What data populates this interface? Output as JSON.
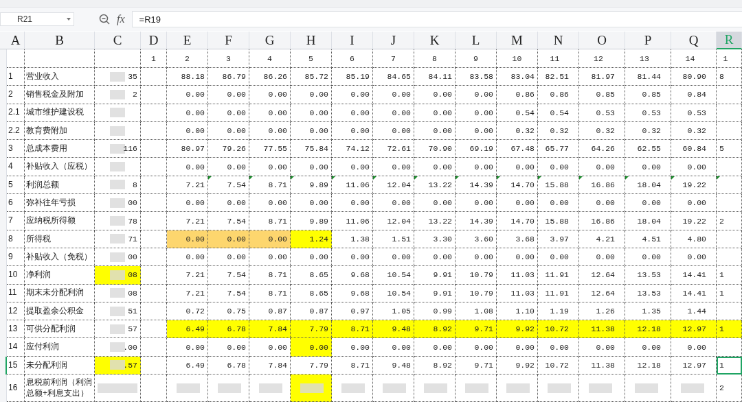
{
  "name_box": "R21",
  "function_label": "fx",
  "formula": "=R19",
  "columns": [
    {
      "label": "A",
      "selected": false
    },
    {
      "label": "B",
      "selected": false
    },
    {
      "label": "C",
      "selected": false
    },
    {
      "label": "D",
      "selected": false
    },
    {
      "label": "E",
      "selected": false
    },
    {
      "label": "F",
      "selected": false
    },
    {
      "label": "G",
      "selected": false
    },
    {
      "label": "H",
      "selected": false
    },
    {
      "label": "I",
      "selected": false
    },
    {
      "label": "J",
      "selected": false
    },
    {
      "label": "K",
      "selected": false
    },
    {
      "label": "L",
      "selected": false
    },
    {
      "label": "M",
      "selected": false
    },
    {
      "label": "N",
      "selected": false
    },
    {
      "label": "O",
      "selected": false
    },
    {
      "label": "P",
      "selected": false
    },
    {
      "label": "Q",
      "selected": false
    },
    {
      "label": "R",
      "selected": true
    }
  ],
  "rows": [
    {
      "a": null,
      "b": null,
      "c": null,
      "selected": false,
      "cells": [
        "1",
        "2",
        "3",
        "4",
        "5",
        "6",
        "7",
        "8",
        "9",
        "10",
        "11",
        "12",
        "13",
        "14",
        "1"
      ]
    },
    {
      "a": "1",
      "b": "营业收入",
      "c": "35",
      "selected": false,
      "cells": [
        null,
        "88.18",
        "86.79",
        "86.26",
        "85.72",
        "85.19",
        "84.65",
        "84.11",
        "83.58",
        "83.04",
        "82.51",
        "81.97",
        "81.44",
        "80.90",
        "8"
      ]
    },
    {
      "a": "2",
      "b": "销售税金及附加",
      "c": "2",
      "selected": false,
      "cells": [
        null,
        "0.00",
        "0.00",
        "0.00",
        "0.00",
        "0.00",
        "0.00",
        "0.00",
        "0.00",
        "0.86",
        "0.86",
        "0.85",
        "0.85",
        "0.84",
        null
      ]
    },
    {
      "a": "2.1",
      "b": "城市维护建设税",
      "c": null,
      "selected": false,
      "cells": [
        null,
        "0.00",
        "0.00",
        "0.00",
        "0.00",
        "0.00",
        "0.00",
        "0.00",
        "0.00",
        "0.54",
        "0.54",
        "0.53",
        "0.53",
        "0.53",
        null
      ]
    },
    {
      "a": "2.2",
      "b": "教育费附加",
      "c": null,
      "selected": false,
      "cells": [
        null,
        "0.00",
        "0.00",
        "0.00",
        "0.00",
        "0.00",
        "0.00",
        "0.00",
        "0.00",
        "0.32",
        "0.32",
        "0.32",
        "0.32",
        "0.32",
        null
      ]
    },
    {
      "a": "3",
      "b": "总成本费用",
      "c": "116",
      "selected": false,
      "cells": [
        null,
        "80.97",
        "79.26",
        "77.55",
        "75.84",
        "74.12",
        "72.61",
        "70.90",
        "69.19",
        "67.48",
        "65.77",
        "64.26",
        "62.55",
        "60.84",
        "5"
      ]
    },
    {
      "a": "4",
      "b": "补贴收入（应税）",
      "c": null,
      "selected": false,
      "cells": [
        null,
        "0.00",
        "0.00",
        "0.00",
        "0.00",
        "0.00",
        "0.00",
        "0.00",
        "0.00",
        "0.00",
        "0.00",
        "0.00",
        "0.00",
        "0.00",
        null
      ]
    },
    {
      "a": "5",
      "b": "利润总额",
      "c": "8",
      "selected": false,
      "cells": [
        null,
        "7.21",
        {
          "text": "7.54",
          "flag": true
        },
        {
          "text": "8.71",
          "flag": true
        },
        {
          "text": "9.89",
          "flag": true
        },
        {
          "text": "11.06",
          "flag": true
        },
        {
          "text": "12.04",
          "flag": true
        },
        {
          "text": "13.22",
          "flag": true
        },
        {
          "text": "14.39",
          "flag": true
        },
        {
          "text": "14.70",
          "flag": true
        },
        {
          "text": "15.88",
          "flag": true
        },
        {
          "text": "16.86",
          "flag": true
        },
        {
          "text": "18.04",
          "flag": true
        },
        {
          "text": "19.22",
          "flag": true
        },
        {
          "text": null,
          "flag": true
        }
      ]
    },
    {
      "a": "6",
      "b": "弥补往年亏损",
      "c": "00",
      "selected": false,
      "cells": [
        null,
        "0.00",
        "0.00",
        "0.00",
        "0.00",
        "0.00",
        "0.00",
        "0.00",
        "0.00",
        "0.00",
        "0.00",
        "0.00",
        "0.00",
        "0.00",
        null
      ]
    },
    {
      "a": "7",
      "b": "应纳税所得额",
      "c": "78",
      "selected": false,
      "cells": [
        null,
        "7.21",
        "7.54",
        "8.71",
        "9.89",
        "11.06",
        "12.04",
        "13.22",
        "14.39",
        "14.70",
        "15.88",
        "16.86",
        "18.04",
        "19.22",
        "2"
      ]
    },
    {
      "a": "8",
      "b": "所得税",
      "c": "71",
      "selected": false,
      "cells": [
        null,
        {
          "text": "0.00",
          "color": "#fdd66e"
        },
        {
          "text": "0.00",
          "color": "#fdd66e"
        },
        {
          "text": "0.00",
          "color": "#fdd66e"
        },
        {
          "text": "1.24",
          "color": "#ffff00"
        },
        "1.38",
        "1.51",
        "3.30",
        "3.60",
        "3.68",
        "3.97",
        "4.21",
        "4.51",
        "4.80",
        null
      ]
    },
    {
      "a": "9",
      "b": "补贴收入（免税）",
      "c": "00",
      "selected": false,
      "cells": [
        null,
        "0.00",
        "0.00",
        "0.00",
        "0.00",
        "0.00",
        "0.00",
        "0.00",
        "0.00",
        "0.00",
        "0.00",
        "0.00",
        "0.00",
        "0.00",
        null
      ]
    },
    {
      "a": "10",
      "b": "净利润",
      "c": {
        "text": "08",
        "color": "#ffff00"
      },
      "selected": false,
      "cells": [
        null,
        "7.21",
        "7.54",
        "8.71",
        "8.65",
        "9.68",
        "10.54",
        "9.91",
        "10.79",
        "11.03",
        "11.91",
        "12.64",
        "13.53",
        "14.41",
        "1"
      ]
    },
    {
      "a": "11",
      "b": "期末未分配利润",
      "c": "08",
      "selected": false,
      "cells": [
        null,
        "7.21",
        "7.54",
        "8.71",
        "8.65",
        "9.68",
        "10.54",
        "9.91",
        "10.79",
        "11.03",
        "11.91",
        "12.64",
        "13.53",
        "14.41",
        "1"
      ]
    },
    {
      "a": "12",
      "b": "提取盈余公积金",
      "c": "51",
      "selected": false,
      "cells": [
        null,
        "0.72",
        "0.75",
        "0.87",
        "0.87",
        "0.97",
        "1.05",
        "0.99",
        "1.08",
        "1.10",
        "1.19",
        "1.26",
        "1.35",
        "1.44",
        null
      ]
    },
    {
      "a": "13",
      "b": "可供分配利润",
      "c": "57",
      "selected": false,
      "cells": [
        null,
        {
          "text": "6.49",
          "color": "#ffff00"
        },
        {
          "text": "6.78",
          "color": "#ffff00"
        },
        {
          "text": "7.84",
          "color": "#ffff00"
        },
        {
          "text": "7.79",
          "color": "#ffff00"
        },
        {
          "text": "8.71",
          "color": "#ffff00"
        },
        {
          "text": "9.48",
          "color": "#ffff00"
        },
        {
          "text": "8.92",
          "color": "#ffff00"
        },
        {
          "text": "9.71",
          "color": "#ffff00"
        },
        {
          "text": "9.92",
          "color": "#ffff00"
        },
        {
          "text": "10.72",
          "color": "#ffff00"
        },
        {
          "text": "11.38",
          "color": "#ffff00"
        },
        {
          "text": "12.18",
          "color": "#ffff00"
        },
        {
          "text": "12.97",
          "color": "#ffff00"
        },
        {
          "text": "1",
          "color": "#ffff00"
        }
      ]
    },
    {
      "a": "14",
      "b": "应付利润",
      "c": ".00",
      "selected": false,
      "cells": [
        null,
        "0.00",
        "0.00",
        "0.00",
        {
          "text": "0.00",
          "color": "#ffff00"
        },
        "0.00",
        "0.00",
        "0.00",
        "0.00",
        "0.00",
        "0.00",
        "0.00",
        "0.00",
        "0.00",
        null
      ]
    },
    {
      "a": "15",
      "b": "未分配利润",
      "c": {
        "text": ".57",
        "color": "#ffff00"
      },
      "selected": true,
      "cells": [
        null,
        "6.49",
        "6.78",
        "7.84",
        "7.79",
        "8.71",
        "9.48",
        "8.92",
        "9.71",
        "9.92",
        "10.72",
        "11.38",
        "12.18",
        "12.97",
        {
          "text": "1",
          "active": true
        }
      ]
    },
    {
      "a": "16",
      "b": "息税前利润（利润总额+利息支出）",
      "c": null,
      "blurred": true,
      "selected": false,
      "cells": [
        null,
        null,
        null,
        null,
        {
          "text": null,
          "color": "#ffff00"
        },
        null,
        null,
        null,
        null,
        null,
        null,
        null,
        null,
        null,
        "2"
      ]
    }
  ]
}
